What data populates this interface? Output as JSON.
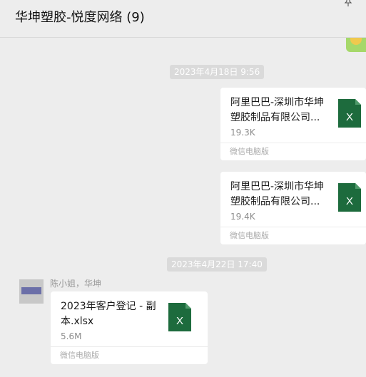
{
  "header": {
    "title": "华坤塑胶-悦度网络 (9)"
  },
  "timestamps": [
    "2023年4月18日 9:56",
    "2023年4月22日 17:40"
  ],
  "messages": [
    {
      "file_name_line1": "阿里巴巴-深圳市华坤",
      "file_name_line2": "塑胶制品有限公司...",
      "size": "19.3K",
      "source": "微信电脑版",
      "icon": "excel-file-icon"
    },
    {
      "file_name_line1": "阿里巴巴-深圳市华坤",
      "file_name_line2": "塑胶制品有限公司...",
      "size": "19.4K",
      "source": "微信电脑版",
      "icon": "excel-file-icon"
    },
    {
      "sender": "陈小姐，华坤",
      "file_name_line1": "2023年客户登记 - 副",
      "file_name_line2": "本.xlsx",
      "size": "5.6M",
      "source": "微信电脑版",
      "icon": "excel-file-icon"
    }
  ],
  "colors": {
    "background": "#ededed",
    "excel_green": "#1d6b3d",
    "timestamp_bg": "#dadada"
  }
}
